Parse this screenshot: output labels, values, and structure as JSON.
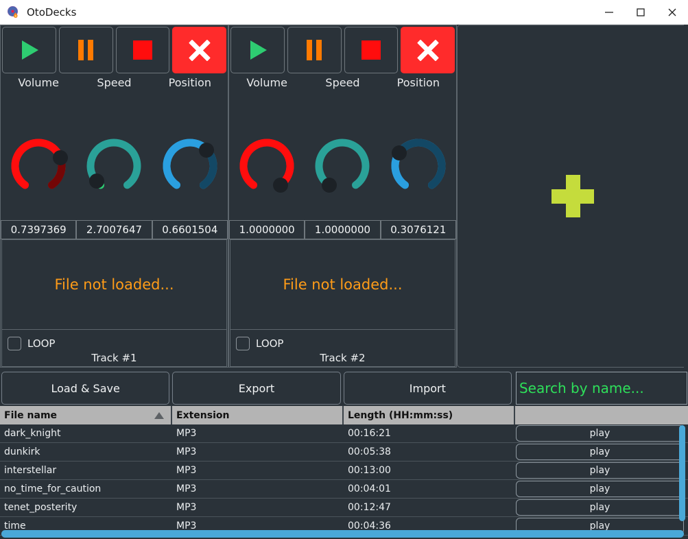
{
  "window": {
    "title": "OtoDecks",
    "icon": "vinyl-record-flame-icon",
    "minimize_label": "Minimize",
    "maximize_label": "Maximize",
    "close_label": "Close"
  },
  "colors": {
    "background": "#2a3239",
    "panel_border": "#5d666d",
    "play_green": "#2ecc71",
    "pause_orange": "#ff7a00",
    "stop_red": "#ff0d0d",
    "eject_red": "#ff2b2b",
    "plus_green": "#c5dc3c",
    "not_loaded_orange": "#ff9c18",
    "search_green": "#2ee05a",
    "scrollbar_blue": "#4aa8d8",
    "header_gray": "#b4b4b4",
    "knob_volume": "#ff0d0d",
    "knob_speed": "#2aa198",
    "knob_speed_accent": "#2ecc71",
    "knob_position": "#2a9fe0"
  },
  "decks": [
    {
      "name": "deck-1",
      "track_label": "Track #1",
      "loop_label": "LOOP",
      "loop_checked": false,
      "status_text": "File not loaded...",
      "transport": [
        {
          "name": "play-button",
          "icon": "play-icon",
          "label": "Play"
        },
        {
          "name": "pause-button",
          "icon": "pause-icon",
          "label": "Pause"
        },
        {
          "name": "stop-button",
          "icon": "stop-icon",
          "label": "Stop"
        },
        {
          "name": "eject-button",
          "icon": "close-x-icon",
          "label": "Eject"
        }
      ],
      "knobs": [
        {
          "name": "volume-knob",
          "label": "Volume",
          "value": "0.7397369",
          "fraction": 0.7397369,
          "color": "#ff0d0d"
        },
        {
          "name": "speed-knob",
          "label": "Speed",
          "value": "2.7007647",
          "fraction": 0.0501,
          "color": "#2aa198"
        },
        {
          "name": "position-knob",
          "label": "Position",
          "value": "0.6601504",
          "fraction": 0.6601504,
          "color": "#2a9fe0"
        }
      ]
    },
    {
      "name": "deck-2",
      "track_label": "Track #2",
      "loop_label": "LOOP",
      "loop_checked": false,
      "status_text": "File not loaded...",
      "transport": [
        {
          "name": "play-button",
          "icon": "play-icon",
          "label": "Play"
        },
        {
          "name": "pause-button",
          "icon": "pause-icon",
          "label": "Pause"
        },
        {
          "name": "stop-button",
          "icon": "stop-icon",
          "label": "Stop"
        },
        {
          "name": "eject-button",
          "icon": "close-x-icon",
          "label": "Eject"
        }
      ],
      "knobs": [
        {
          "name": "volume-knob",
          "label": "Volume",
          "value": "1.0000000",
          "fraction": 1.0,
          "color": "#ff0d0d"
        },
        {
          "name": "speed-knob",
          "label": "Speed",
          "value": "1.0000000",
          "fraction": 0.0,
          "color": "#2aa198"
        },
        {
          "name": "position-knob",
          "label": "Position",
          "value": "0.3076121",
          "fraction": 0.3076121,
          "color": "#2a9fe0"
        }
      ]
    }
  ],
  "drop_panel": {
    "name": "file-drop-panel",
    "icon": "plus-icon",
    "hint": "Add files"
  },
  "toolbar": {
    "load_save_label": "Load & Save",
    "export_label": "Export",
    "import_label": "Import",
    "search_placeholder": "Search by name...",
    "search_value": ""
  },
  "table": {
    "columns": [
      {
        "label": "File name",
        "sort": "ascending"
      },
      {
        "label": "Extension",
        "sort": null
      },
      {
        "label": "Length (HH:mm:ss)",
        "sort": null
      },
      {
        "label": "",
        "sort": null
      }
    ],
    "rows": [
      {
        "file_name": "dark_knight",
        "extension": "MP3",
        "length": "00:16:21",
        "action": "play"
      },
      {
        "file_name": "dunkirk",
        "extension": "MP3",
        "length": "00:05:38",
        "action": "play"
      },
      {
        "file_name": "interstellar",
        "extension": "MP3",
        "length": "00:13:00",
        "action": "play"
      },
      {
        "file_name": "no_time_for_caution",
        "extension": "MP3",
        "length": "00:04:01",
        "action": "play"
      },
      {
        "file_name": "tenet_posterity",
        "extension": "MP3",
        "length": "00:12:47",
        "action": "play"
      },
      {
        "file_name": "time",
        "extension": "MP3",
        "length": "00:04:36",
        "action": "play"
      }
    ]
  }
}
